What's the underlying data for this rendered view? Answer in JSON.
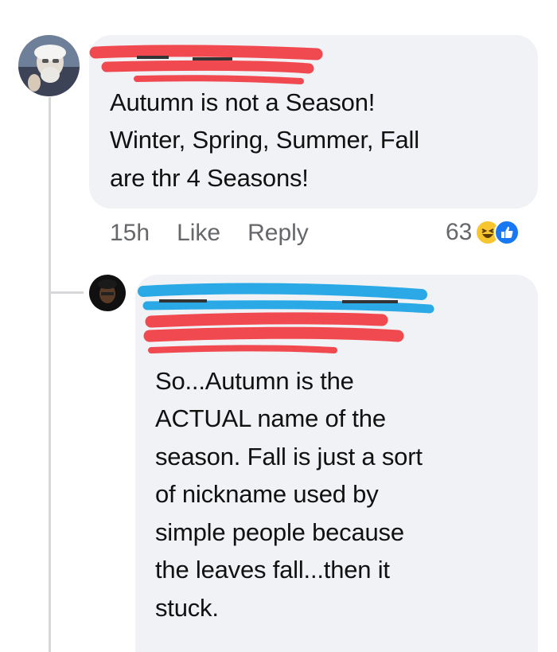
{
  "comment": {
    "text": "Autumn is not a Season!\nWinter, Spring, Summer, Fall\nare thr 4 Seasons!",
    "actions": {
      "time": "15h",
      "like": "Like",
      "reply": "Reply"
    },
    "reaction_count": "63",
    "reaction_icons": [
      "haha-icon",
      "like-icon"
    ]
  },
  "reply": {
    "text": "So...Autumn is the\nACTUAL name of the\nseason. Fall is just a sort\nof nickname used by\nsimple people because\nthe leaves fall...then it\nstuck."
  },
  "colors": {
    "bubble": "#f0f2f5",
    "redact_red": "#f04a50",
    "redact_blue": "#2aa9e6",
    "muted_text": "#65676b",
    "like_blue": "#1877f2",
    "haha_yellow": "#f7c530"
  }
}
